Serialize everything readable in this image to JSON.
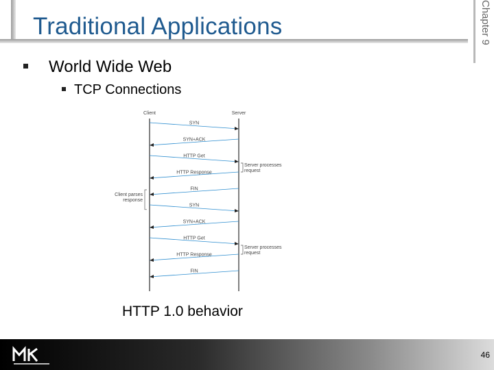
{
  "slide": {
    "chapter_label": "Chapter 9",
    "title": "Traditional Applications",
    "bullet_level1": "World Wide Web",
    "bullet_level2": "TCP Connections",
    "caption": "HTTP 1.0 behavior",
    "page_number": "46",
    "logo_alt": "Morgan Kaufmann",
    "colors": {
      "title": "#1f5a8f",
      "diagram_lines": "#2b2b2b",
      "arrows": "#2a8ccf"
    }
  },
  "diagram": {
    "client_label": "Client",
    "server_label": "Server",
    "messages": [
      {
        "label": "SYN",
        "direction": "client_to_server"
      },
      {
        "label": "SYN+ACK",
        "direction": "server_to_client"
      },
      {
        "label": "HTTP Get",
        "direction": "client_to_server"
      },
      {
        "label": "HTTP Response",
        "direction": "server_to_client"
      },
      {
        "label": "FIN",
        "direction": "server_to_client"
      },
      {
        "label": "SYN",
        "direction": "client_to_server"
      },
      {
        "label": "SYN+ACK",
        "direction": "server_to_client"
      },
      {
        "label": "HTTP Get",
        "direction": "client_to_server"
      },
      {
        "label": "HTTP Response",
        "direction": "server_to_client"
      },
      {
        "label": "FIN",
        "direction": "server_to_client"
      }
    ],
    "server_notes": [
      {
        "line1": "Server processes",
        "line2": "request"
      },
      {
        "line1": "Server processes",
        "line2": "request"
      }
    ],
    "client_note": {
      "line1": "Client parses",
      "line2": "response"
    }
  }
}
